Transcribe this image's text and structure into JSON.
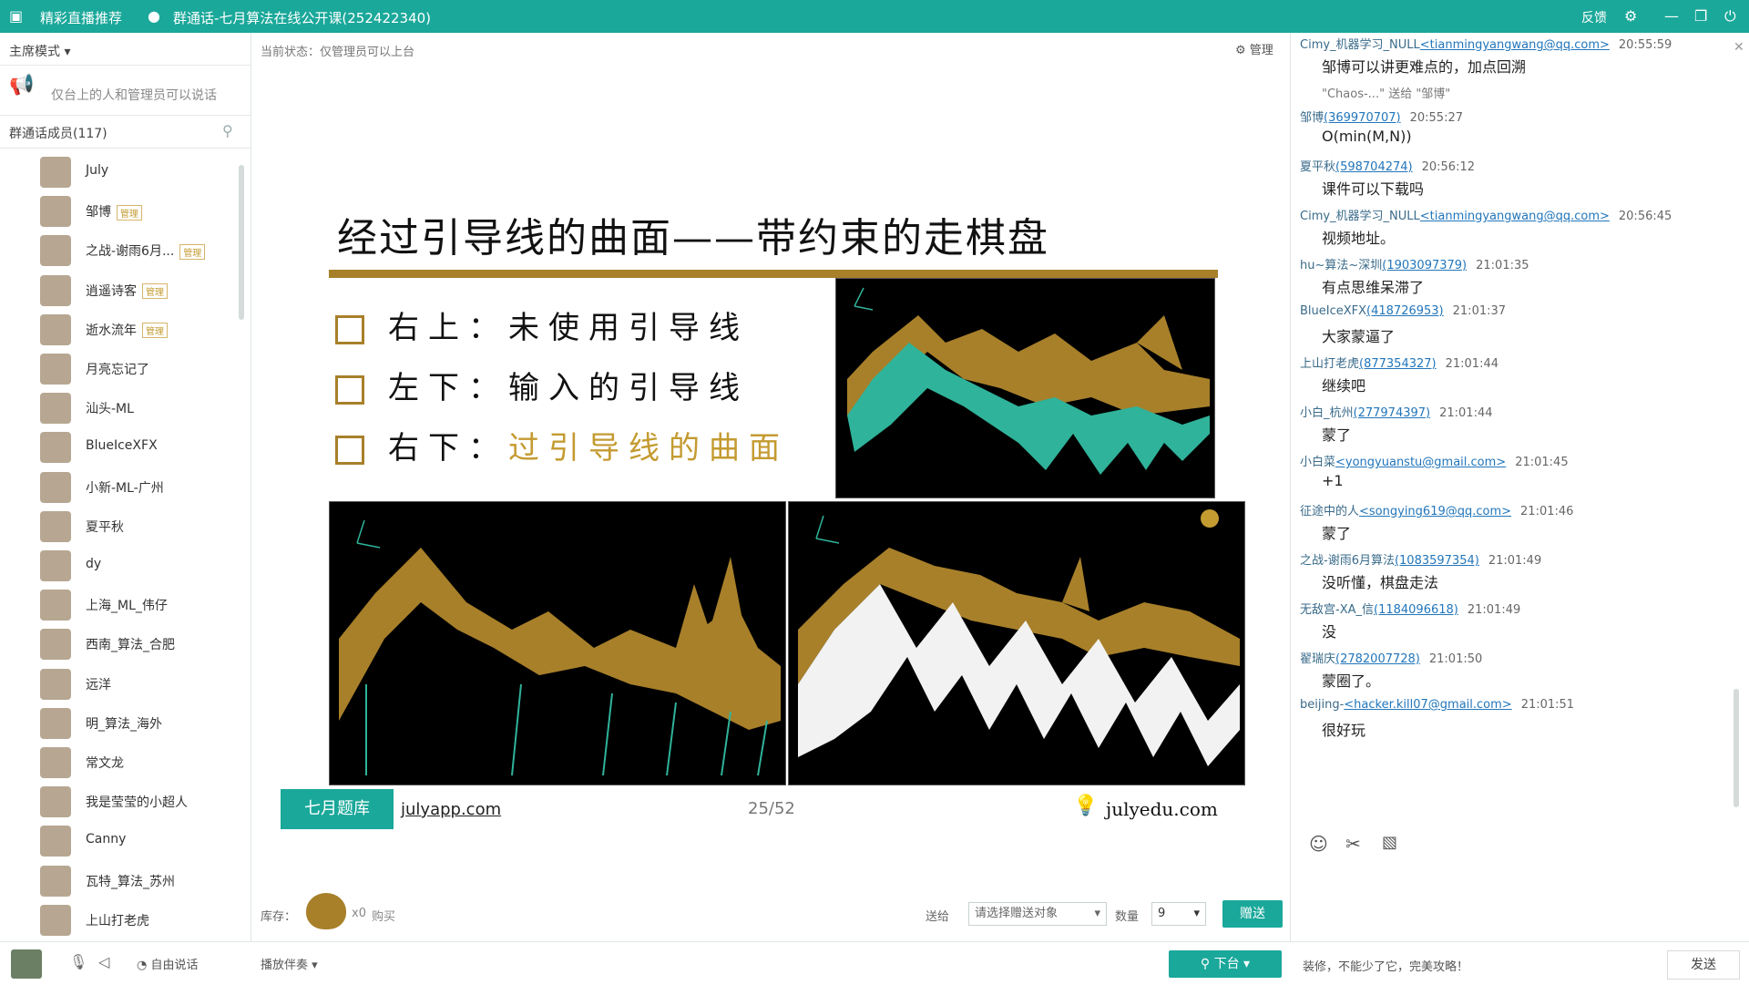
{
  "titlebar": {
    "app_name": "精彩直播推荐",
    "window_title": "群通话-七月算法在线公开课(252422340)",
    "feedback": "反馈"
  },
  "left": {
    "mode_label": "主席模式",
    "notice": "仅台上的人和管理员可以说话",
    "members_header": "群通话成员(117)",
    "members": [
      {
        "name": "July",
        "badge": ""
      },
      {
        "name": "邹博",
        "badge": "管理"
      },
      {
        "name": "之战-谢雨6月...",
        "badge": "管理"
      },
      {
        "name": "逍遥诗客",
        "badge": "管理"
      },
      {
        "name": "逝水流年",
        "badge": "管理"
      },
      {
        "name": "月亮忘记了",
        "badge": ""
      },
      {
        "name": "汕头-ML",
        "badge": ""
      },
      {
        "name": "BlueIceXFX",
        "badge": ""
      },
      {
        "name": "小新-ML-广州",
        "badge": ""
      },
      {
        "name": "夏平秋",
        "badge": ""
      },
      {
        "name": "dy",
        "badge": ""
      },
      {
        "name": "上海_ML_伟仔",
        "badge": ""
      },
      {
        "name": "西南_算法_合肥",
        "badge": ""
      },
      {
        "name": "远洋",
        "badge": ""
      },
      {
        "name": "明_算法_海外",
        "badge": ""
      },
      {
        "name": "常文龙",
        "badge": ""
      },
      {
        "name": "我是莹莹的小超人",
        "badge": ""
      },
      {
        "name": "Canny",
        "badge": ""
      },
      {
        "name": "瓦特_算法_苏州",
        "badge": ""
      },
      {
        "name": "上山打老虎",
        "badge": ""
      }
    ]
  },
  "center": {
    "status": "当前状态：仅管理员可以上台",
    "manage": "管理",
    "slide": {
      "title": "经过引导线的曲面——带约束的走棋盘",
      "bullets": [
        {
          "prefix": "右上：",
          "text": "未使用引导线",
          "highlight": false
        },
        {
          "prefix": "左下：",
          "text": "输入的引导线",
          "highlight": false
        },
        {
          "prefix": "右下：",
          "text": "过引导线的曲面",
          "highlight": true
        }
      ],
      "logo_text": "七月题库",
      "logo_site": "julyapp.com",
      "page": "25/52",
      "site": "julyedu.com"
    },
    "inventory_label": "库存：",
    "inventory_count": "x0",
    "buy": "购买",
    "gift_to_label": "送给",
    "gift_to_placeholder": "请选择赠送对象",
    "qty_label": "数量",
    "qty_value": "9",
    "gift_button": "赠送"
  },
  "chat": {
    "messages": [
      {
        "sender": "Cimy_机器学习_NULL",
        "id": "<tianmingyangwang@qq.com>",
        "time": "20:55:59",
        "text": "邹博可以讲更难点的，加点回溯"
      },
      {
        "sender": "",
        "id": "",
        "time": "",
        "text": "\"Chaos-...\" 送给 \"邹博\""
      },
      {
        "sender": "邹博",
        "id": "(369970707)",
        "time": "20:55:27",
        "text": "O(min(M,N))"
      },
      {
        "sender": "夏平秋",
        "id": "(598704274)",
        "time": "20:56:12",
        "text": "课件可以下载吗"
      },
      {
        "sender": "Cimy_机器学习_NULL",
        "id": "<tianmingyangwang@qq.com>",
        "time": "20:56:45",
        "text": "视频地址。"
      },
      {
        "sender": "hu~算法~深圳",
        "id": "(1903097379)",
        "time": "21:01:35",
        "text": "有点思维呆滞了"
      },
      {
        "sender": "BlueIceXFX",
        "id": "(418726953)",
        "time": "21:01:37",
        "text": "大家蒙逼了"
      },
      {
        "sender": "上山打老虎",
        "id": "(877354327)",
        "time": "21:01:44",
        "text": "继续吧"
      },
      {
        "sender": "小白_杭州",
        "id": "(277974397)",
        "time": "21:01:44",
        "text": "蒙了"
      },
      {
        "sender": "小白菜",
        "id": "<yongyuanstu@gmail.com>",
        "time": "21:01:45",
        "text": "+1"
      },
      {
        "sender": "征途中的人",
        "id": "<songying619@qq.com>",
        "time": "21:01:46",
        "text": "蒙了"
      },
      {
        "sender": "之战-谢雨6月算法",
        "id": "(1083597354)",
        "time": "21:01:49",
        "text": "没听懂，棋盘走法"
      },
      {
        "sender": "无敌宫-XA_信",
        "id": "(1184096618)",
        "time": "21:01:49",
        "text": "没"
      },
      {
        "sender": "翟瑞庆",
        "id": "(2782007728)",
        "time": "21:01:50",
        "text": "蒙圈了。"
      },
      {
        "sender": "beijing-",
        "id": "<hacker.kill07@gmail.com>",
        "time": "21:01:51",
        "text": "很好玩"
      }
    ],
    "input_text": "装修，不能少了它，完美攻略！",
    "send_button": "发送"
  },
  "bottom": {
    "free_talk": "自由说话",
    "play_accompany": "播放伴奏",
    "stage_button": "下台"
  },
  "colors": {
    "teal": "#1aa89a",
    "gold": "#a8802a",
    "plot_teal": "#2fb39a",
    "plot_white": "#f2f2f2"
  }
}
